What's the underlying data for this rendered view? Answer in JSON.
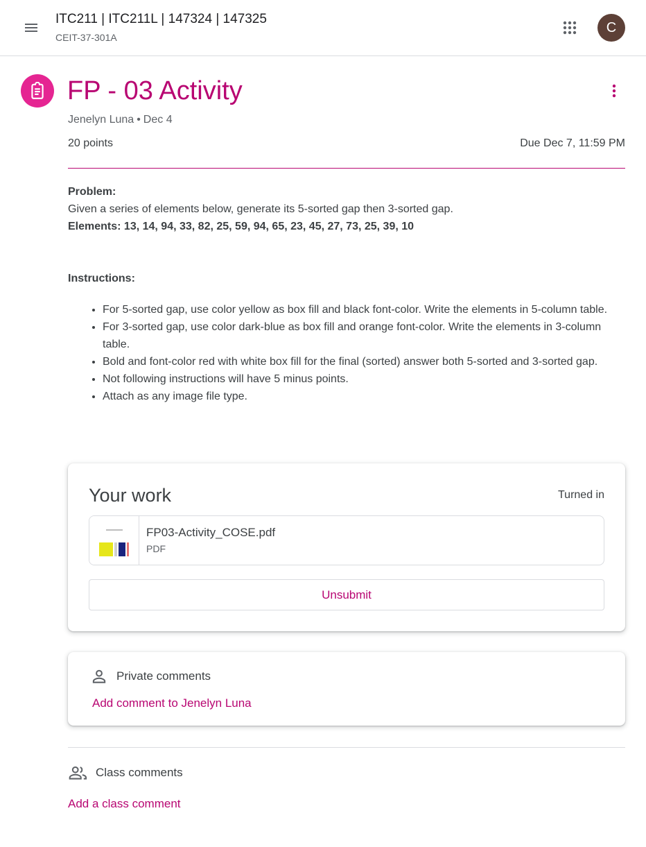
{
  "header": {
    "class_title": "ITC211 | ITC211L | 147324 | 147325",
    "class_section": "CEIT-37-301A",
    "avatar_letter": "C",
    "icons": {
      "menu": "hamburger-menu-icon",
      "apps": "google-apps-grid-icon"
    }
  },
  "assignment": {
    "icon": "assignment-clipboard-icon",
    "title": "FP - 03 Activity",
    "author": "Jenelyn Luna",
    "separator": "•",
    "posted_date": "Dec 4",
    "points": "20 points",
    "due": "Due Dec 7, 11:59 PM",
    "accent_color": "#b80672",
    "icon_color": "#e52592"
  },
  "description": {
    "problem_label": "Problem:",
    "problem_text": "Given a series of elements below, generate its 5-sorted gap then 3-sorted gap.",
    "elements_text": "Elements: 13, 14, 94, 33, 82, 25, 59, 94, 65, 23, 45, 27, 73, 25, 39, 10",
    "instructions_label": "Instructions:",
    "instructions": [
      "For 5-sorted gap, use color yellow as box fill and black font-color. Write the elements in 5-column table.",
      "For 3-sorted gap, use color dark-blue as box fill and orange font-color. Write the elements in 3-column table.",
      "Bold and font-color red with white box fill for the final (sorted) answer both 5-sorted and 3-sorted gap.",
      "Not following instructions will have 5 minus points.",
      "Attach as any image file type."
    ]
  },
  "your_work": {
    "title": "Your work",
    "status": "Turned in",
    "attachment": {
      "name": "FP03-Activity_COSE.pdf",
      "type": "PDF"
    },
    "unsubmit_label": "Unsubmit"
  },
  "private_comments": {
    "icon": "person-icon",
    "label": "Private comments",
    "add_label": "Add comment to Jenelyn Luna"
  },
  "class_comments": {
    "icon": "people-icon",
    "label": "Class comments",
    "add_label": "Add a class comment"
  }
}
